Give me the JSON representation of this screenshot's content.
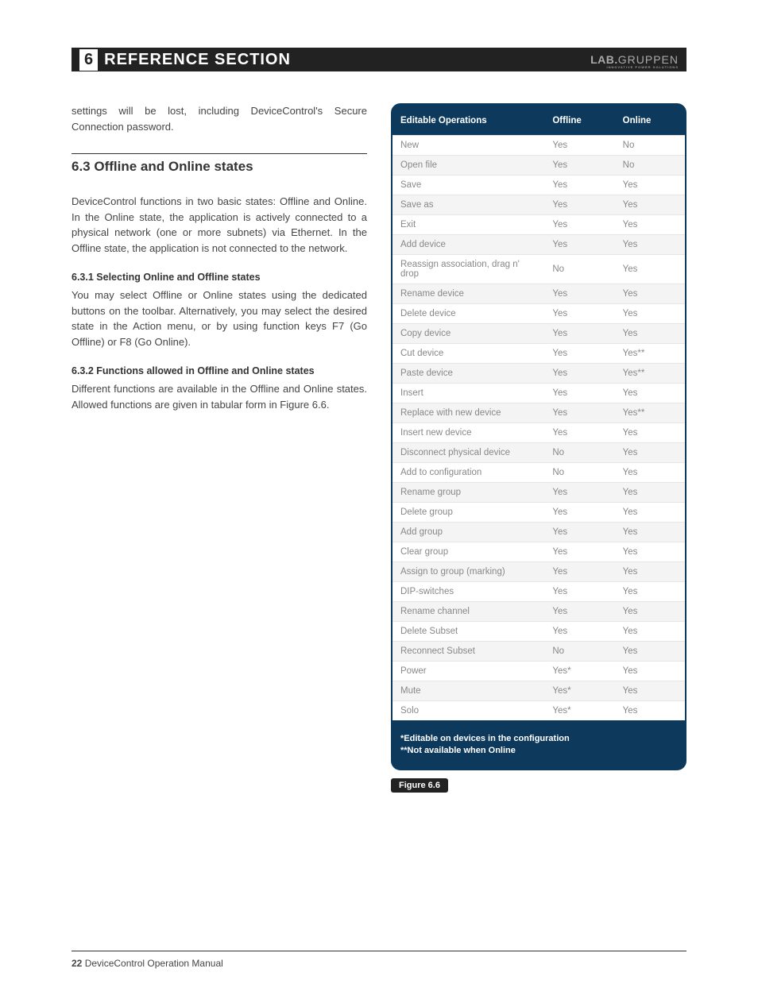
{
  "header": {
    "number": "6",
    "title": "REFERENCE SECTION",
    "brand_lab": "LAB.",
    "brand_gruppen": "GRUPPEN",
    "brand_sub": "INNOVATIVE POWER SOLUTIONS"
  },
  "left": {
    "intro": "settings will be lost, including DeviceControl's Secure Connection password.",
    "section_heading": "6.3  Offline and Online states",
    "section_body": "DeviceControl functions in two basic states: Offline and Online. In the Online state, the application is actively connected to a physical network (one or more subnets) via Ethernet. In the Offline state, the application is not connected to the network.",
    "sub1_heading": "6.3.1  Selecting Online and Offline states",
    "sub1_body": "You may select Offline or Online states using the dedicated buttons on the toolbar. Alternatively, you may select the desired state in the Action menu, or by using function keys F7 (Go Offline) or F8 (Go Online).",
    "sub2_heading": "6.3.2  Functions allowed in Offline and Online states",
    "sub2_body": "Different functions are available in the Offline and Online states. Allowed functions are given in tabular form in Figure 6.6."
  },
  "table": {
    "headers": {
      "c1": "Editable Operations",
      "c2": "Offline",
      "c3": "Online"
    },
    "rows": [
      {
        "op": "New",
        "offline": "Yes",
        "online": "No"
      },
      {
        "op": "Open file",
        "offline": "Yes",
        "online": "No"
      },
      {
        "op": "Save",
        "offline": "Yes",
        "online": "Yes"
      },
      {
        "op": "Save as",
        "offline": "Yes",
        "online": "Yes"
      },
      {
        "op": "Exit",
        "offline": "Yes",
        "online": "Yes"
      },
      {
        "op": "Add device",
        "offline": "Yes",
        "online": "Yes"
      },
      {
        "op": "Reassign association, drag n' drop",
        "offline": "No",
        "online": "Yes"
      },
      {
        "op": "Rename device",
        "offline": "Yes",
        "online": "Yes"
      },
      {
        "op": "Delete device",
        "offline": "Yes",
        "online": "Yes"
      },
      {
        "op": "Copy device",
        "offline": "Yes",
        "online": "Yes"
      },
      {
        "op": "Cut device",
        "offline": "Yes",
        "online": "Yes**"
      },
      {
        "op": "Paste device",
        "offline": "Yes",
        "online": "Yes**"
      },
      {
        "op": "Insert",
        "offline": "Yes",
        "online": "Yes"
      },
      {
        "op": "Replace with new device",
        "offline": "Yes",
        "online": "Yes**"
      },
      {
        "op": "Insert new device",
        "offline": "Yes",
        "online": "Yes"
      },
      {
        "op": "Disconnect physical device",
        "offline": "No",
        "online": "Yes"
      },
      {
        "op": "Add to configuration",
        "offline": "No",
        "online": "Yes"
      },
      {
        "op": "Rename group",
        "offline": "Yes",
        "online": "Yes"
      },
      {
        "op": "Delete group",
        "offline": "Yes",
        "online": "Yes"
      },
      {
        "op": "Add group",
        "offline": "Yes",
        "online": "Yes"
      },
      {
        "op": "Clear group",
        "offline": "Yes",
        "online": "Yes"
      },
      {
        "op": "Assign to group (marking)",
        "offline": "Yes",
        "online": "Yes"
      },
      {
        "op": "DIP-switches",
        "offline": "Yes",
        "online": "Yes"
      },
      {
        "op": "Rename channel",
        "offline": "Yes",
        "online": "Yes"
      },
      {
        "op": "Delete Subset",
        "offline": "Yes",
        "online": "Yes"
      },
      {
        "op": "Reconnect Subset",
        "offline": "No",
        "online": "Yes"
      },
      {
        "op": "Power",
        "offline": "Yes*",
        "online": "Yes"
      },
      {
        "op": "Mute",
        "offline": "Yes*",
        "online": "Yes"
      },
      {
        "op": "Solo",
        "offline": "Yes*",
        "online": "Yes"
      }
    ],
    "footnote1": "*Editable on devices in the configuration",
    "footnote2": "**Not available when Online",
    "figure_label": "Figure 6.6"
  },
  "footer": {
    "page_number": "22",
    "manual_title": "  DeviceControl Operation Manual"
  }
}
